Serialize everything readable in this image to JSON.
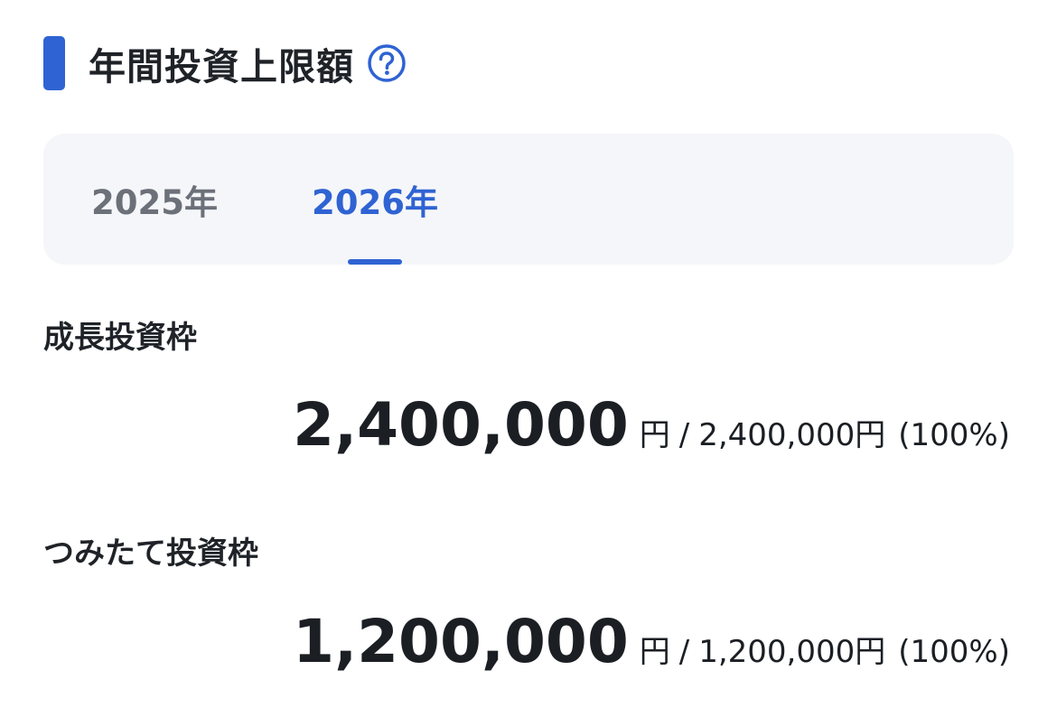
{
  "header": {
    "title": "年間投資上限額",
    "help_icon": "question-circle-icon",
    "accent_color": "#2f63d3"
  },
  "tabs": [
    {
      "label": "2025年",
      "selected": false
    },
    {
      "label": "2026年",
      "selected": true
    }
  ],
  "quotas": [
    {
      "label": "成長投資枠",
      "used": "2,400,000",
      "unit": "円",
      "separator": "/",
      "limit": "2,400,000円",
      "percent": "(100%)"
    },
    {
      "label": "つみたて投資枠",
      "used": "1,200,000",
      "unit": "円",
      "separator": "/",
      "limit": "1,200,000円",
      "percent": "(100%)"
    }
  ]
}
